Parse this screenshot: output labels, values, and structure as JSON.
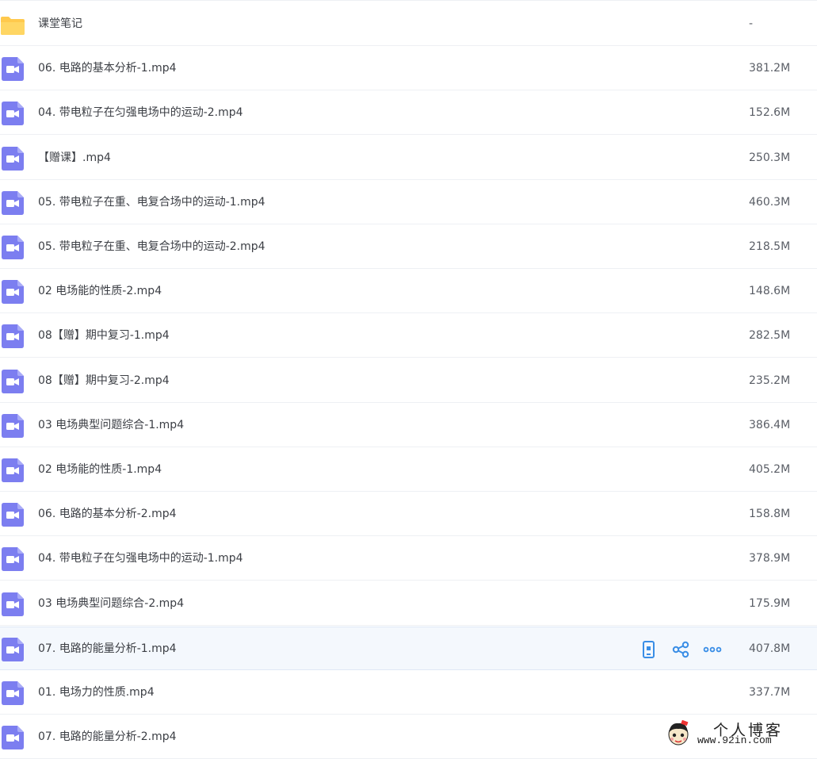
{
  "files": [
    {
      "name": "课堂笔记",
      "size": "-",
      "type": "folder"
    },
    {
      "name": "06. 电路的基本分析-1.mp4",
      "size": "381.2M",
      "type": "video"
    },
    {
      "name": "04. 带电粒子在匀强电场中的运动-2.mp4",
      "size": "152.6M",
      "type": "video"
    },
    {
      "name": "【赠课】.mp4",
      "size": "250.3M",
      "type": "video"
    },
    {
      "name": "05. 带电粒子在重、电复合场中的运动-1.mp4",
      "size": "460.3M",
      "type": "video"
    },
    {
      "name": "05. 带电粒子在重、电复合场中的运动-2.mp4",
      "size": "218.5M",
      "type": "video"
    },
    {
      "name": "02 电场能的性质-2.mp4",
      "size": "148.6M",
      "type": "video"
    },
    {
      "name": "08【赠】期中复习-1.mp4",
      "size": "282.5M",
      "type": "video"
    },
    {
      "name": "08【赠】期中复习-2.mp4",
      "size": "235.2M",
      "type": "video"
    },
    {
      "name": "03 电场典型问题综合-1.mp4",
      "size": "386.4M",
      "type": "video"
    },
    {
      "name": "02 电场能的性质-1.mp4",
      "size": "405.2M",
      "type": "video"
    },
    {
      "name": "06. 电路的基本分析-2.mp4",
      "size": "158.8M",
      "type": "video"
    },
    {
      "name": "04. 带电粒子在匀强电场中的运动-1.mp4",
      "size": "378.9M",
      "type": "video"
    },
    {
      "name": "03 电场典型问题综合-2.mp4",
      "size": "175.9M",
      "type": "video"
    },
    {
      "name": "07. 电路的能量分析-1.mp4",
      "size": "407.8M",
      "type": "video",
      "hovered": true
    },
    {
      "name": "01. 电场力的性质.mp4",
      "size": "337.7M",
      "type": "video"
    },
    {
      "name": "07. 电路的能量分析-2.mp4",
      "size": "",
      "type": "video"
    }
  ],
  "row_actions": [
    "phone-icon",
    "share-icon",
    "more-icon"
  ],
  "watermark": {
    "title": "个人博客",
    "url": "www.92in.com"
  },
  "colors": {
    "video_icon": "#7c7ef0",
    "folder_icon": "#ffc94d",
    "action_icon": "#3a8ee6",
    "hover_bg": "#f4f8fd"
  }
}
